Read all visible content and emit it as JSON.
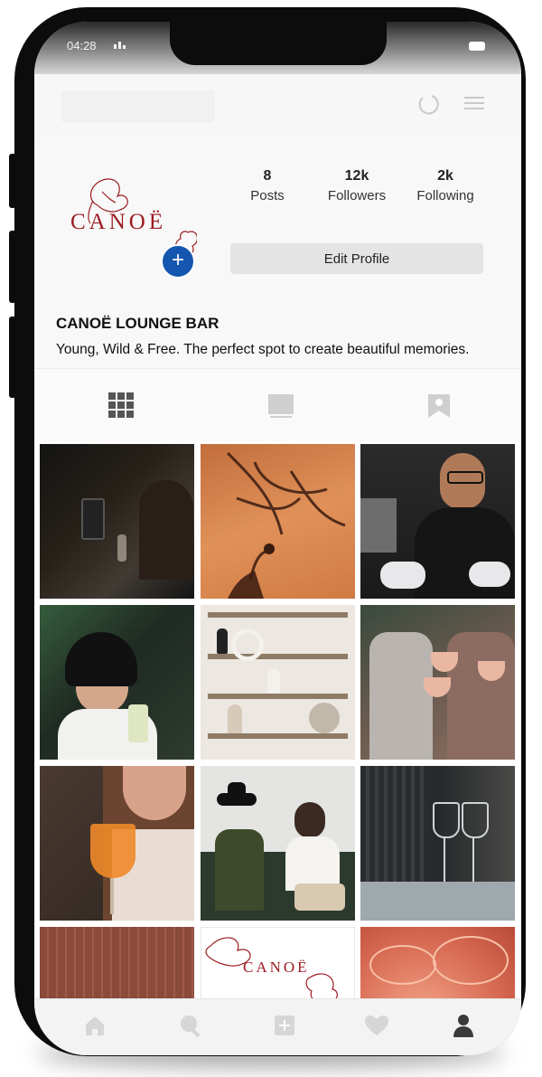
{
  "status": {
    "time": "04:28"
  },
  "profile": {
    "logo_text": "CANOË",
    "add_symbol": "+",
    "stats": [
      {
        "value": "8",
        "label": "Posts"
      },
      {
        "value": "12k",
        "label": "Followers"
      },
      {
        "value": "2k",
        "label": "Following"
      }
    ],
    "edit_label": "Edit Profile",
    "name": "CANOË LOUNGE BAR",
    "bio": "Young, Wild & Free. The perfect spot to create beautiful memories."
  },
  "tabs": [
    {
      "icon": "grid-icon",
      "active": true
    },
    {
      "icon": "reels-icon",
      "active": false
    },
    {
      "icon": "tagged-icon",
      "active": false
    }
  ],
  "grid": {
    "logo_tile_text": "CANOË",
    "tiles": [
      "photo-guests-with-phone",
      "photo-flower-shadow",
      "photo-chef",
      "photo-woman-with-drink",
      "photo-shelf-decor",
      "photo-toasting-glasses",
      "photo-woman-with-cocktail",
      "photo-couple-conversation",
      "photo-wine-glasses",
      "photo-brown-panel",
      "photo-logo",
      "photo-coral-petals"
    ]
  },
  "nav": [
    "home-icon",
    "search-icon",
    "add-post-icon",
    "heart-icon",
    "profile-icon"
  ],
  "colors": {
    "accent_blue": "#1556b0",
    "logo_red": "#9c1c22",
    "phone_frame": "#0c0c0c"
  }
}
